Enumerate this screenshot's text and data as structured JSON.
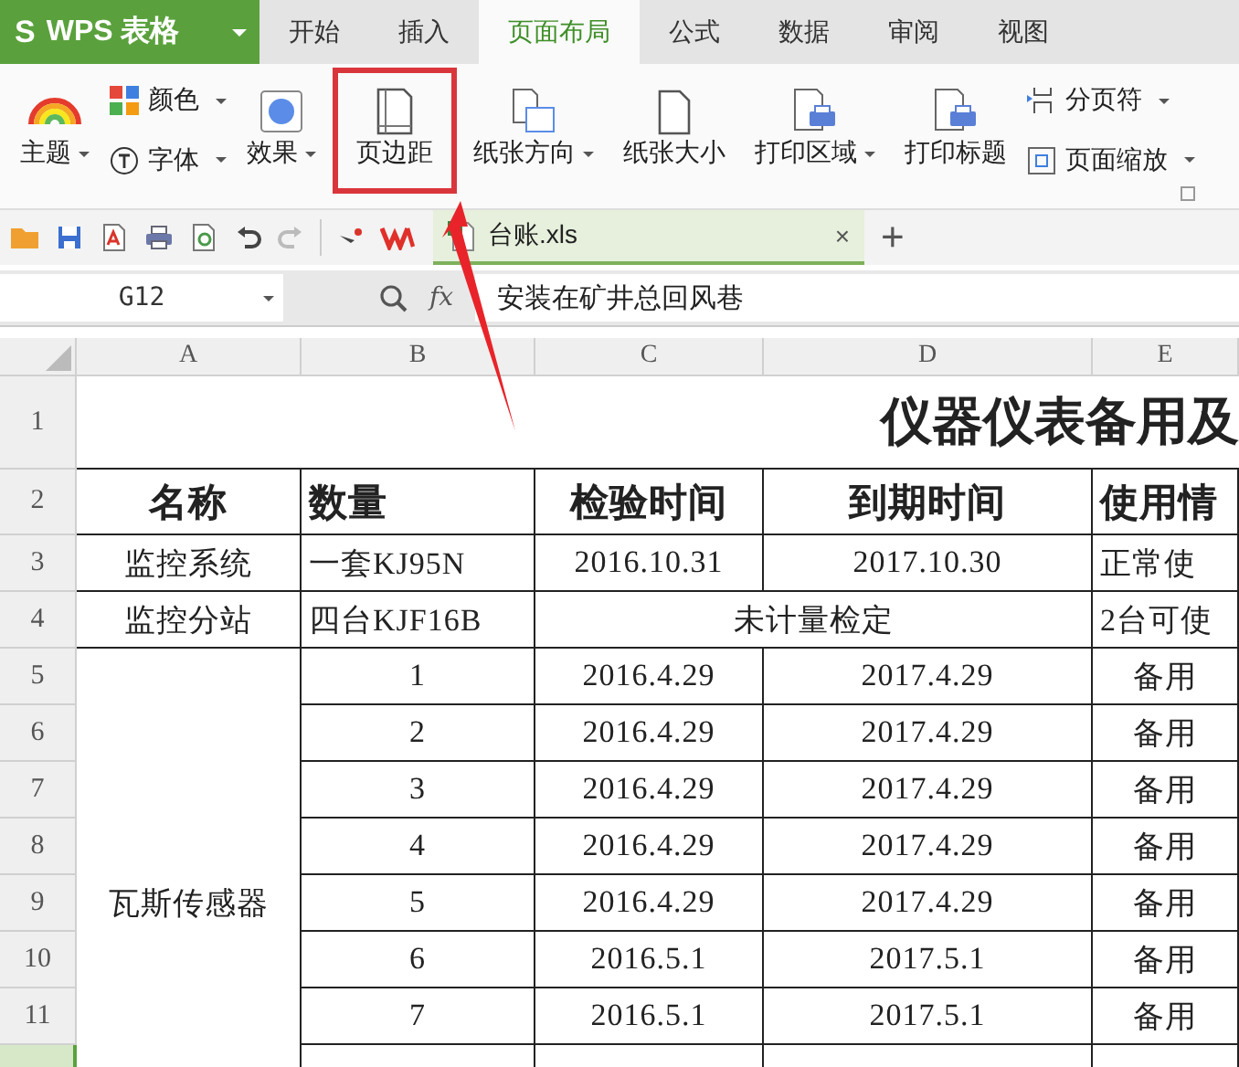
{
  "app": {
    "logo": "S",
    "title": "WPS 表格",
    "menu_dropdown": true
  },
  "tabs": [
    {
      "label": "开始",
      "selected": false
    },
    {
      "label": "插入",
      "selected": false
    },
    {
      "label": "页面布局",
      "selected": true
    },
    {
      "label": "公式",
      "selected": false
    },
    {
      "label": "数据",
      "selected": false
    },
    {
      "label": "审阅",
      "selected": false
    },
    {
      "label": "视图",
      "selected": false
    }
  ],
  "ribbon": [
    {
      "kind": "large",
      "label": "主题",
      "dropdown": true,
      "highlighted": false
    },
    {
      "kind": "stack",
      "items": [
        {
          "label": "颜色",
          "dropdown": true
        },
        {
          "label": "字体",
          "dropdown": true
        }
      ]
    },
    {
      "kind": "large",
      "label": "效果",
      "dropdown": true,
      "highlighted": false
    },
    {
      "kind": "large",
      "label": "页边距",
      "dropdown": false,
      "highlighted": true
    },
    {
      "kind": "large",
      "label": "纸张方向",
      "dropdown": true,
      "highlighted": false
    },
    {
      "kind": "large",
      "label": "纸张大小",
      "dropdown": false,
      "highlighted": false
    },
    {
      "kind": "large",
      "label": "打印区域",
      "dropdown": true,
      "highlighted": false
    },
    {
      "kind": "large",
      "label": "打印标题",
      "dropdown": false,
      "highlighted": false
    },
    {
      "kind": "stack",
      "items": [
        {
          "label": "分页符",
          "dropdown": true
        },
        {
          "label": "页面缩放",
          "dropdown": true
        }
      ]
    }
  ],
  "document_tab": {
    "name": "台账.xls",
    "close": "×"
  },
  "new_tab": "+",
  "formula_bar": {
    "name_box": "G12",
    "fx": "fx",
    "value": "安装在矿井总回风巷"
  },
  "columns": [
    "A",
    "B",
    "C",
    "D",
    "E"
  ],
  "rows": [
    {
      "number": "1",
      "kind": "title",
      "cells": [
        "仪器仪表备用及"
      ]
    },
    {
      "number": "2",
      "kind": "header",
      "cells": [
        "名称",
        "数量",
        "检验时间",
        "到期时间",
        "使用情"
      ]
    },
    {
      "number": "3",
      "kind": "normal",
      "cells": [
        "监控系统",
        "一套KJ95N",
        "2016.10.31",
        "2017.10.30",
        "正常使"
      ]
    },
    {
      "number": "4",
      "kind": "merged",
      "cells": [
        "监控分站",
        "四台KJF16B",
        "未计量检定",
        "2台可使"
      ]
    },
    {
      "number": "5",
      "kind": "group",
      "group_label": "瓦斯传感器",
      "cells": [
        "1",
        "2016.4.29",
        "2017.4.29",
        "备用"
      ]
    },
    {
      "number": "6",
      "kind": "group",
      "cells": [
        "2",
        "2016.4.29",
        "2017.4.29",
        "备用"
      ]
    },
    {
      "number": "7",
      "kind": "group",
      "cells": [
        "3",
        "2016.4.29",
        "2017.4.29",
        "备用"
      ]
    },
    {
      "number": "8",
      "kind": "group",
      "cells": [
        "4",
        "2016.4.29",
        "2017.4.29",
        "备用"
      ]
    },
    {
      "number": "9",
      "kind": "group",
      "cells": [
        "5",
        "2016.4.29",
        "2017.4.29",
        "备用"
      ]
    },
    {
      "number": "10",
      "kind": "group",
      "cells": [
        "6",
        "2016.5.1",
        "2017.5.1",
        "备用"
      ]
    },
    {
      "number": "11",
      "kind": "group",
      "cells": [
        "7",
        "2016.5.1",
        "2017.5.1",
        "备用"
      ]
    },
    {
      "kind": "cut",
      "selected": true
    }
  ]
}
